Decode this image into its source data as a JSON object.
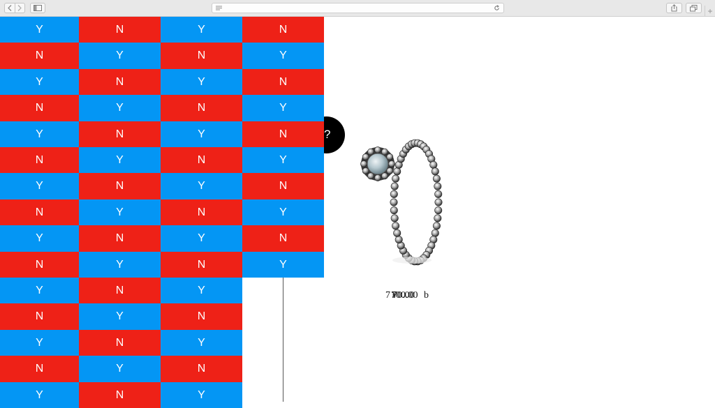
{
  "browser": {
    "back_icon": "chevron-left",
    "forward_icon": "chevron-right",
    "sidebar_icon": "sidebar",
    "address_value": "",
    "share_icon": "share",
    "tabs_icon": "tabs",
    "new_tab_label": "+"
  },
  "grid": {
    "colors": {
      "Y": "#0496f4",
      "N": "#ee2117"
    },
    "rows": [
      [
        "Y",
        "N",
        "Y",
        "N"
      ],
      [
        "N",
        "Y",
        "N",
        "Y"
      ],
      [
        "Y",
        "N",
        "Y",
        "N"
      ],
      [
        "N",
        "Y",
        "N",
        "Y"
      ],
      [
        "Y",
        "N",
        "Y",
        "N"
      ],
      [
        "N",
        "Y",
        "N",
        "Y"
      ],
      [
        "Y",
        "N",
        "Y",
        "N"
      ],
      [
        "N",
        "Y",
        "N",
        "Y"
      ],
      [
        "Y",
        "N",
        "Y",
        "N"
      ],
      [
        "N",
        "Y",
        "N",
        "Y"
      ],
      [
        "Y",
        "N",
        "Y"
      ],
      [
        "N",
        "Y",
        "N"
      ],
      [
        "Y",
        "N",
        "Y"
      ],
      [
        "N",
        "Y",
        "N"
      ],
      [
        "Y",
        "N",
        "Y"
      ]
    ]
  },
  "why_badge": {
    "text": "uy?"
  },
  "product": {
    "image_name": "silver beaded ring with pale stone",
    "price_texts": [
      "7 ",
      "¥",
      "70.00",
      "700.00",
      "b"
    ]
  }
}
